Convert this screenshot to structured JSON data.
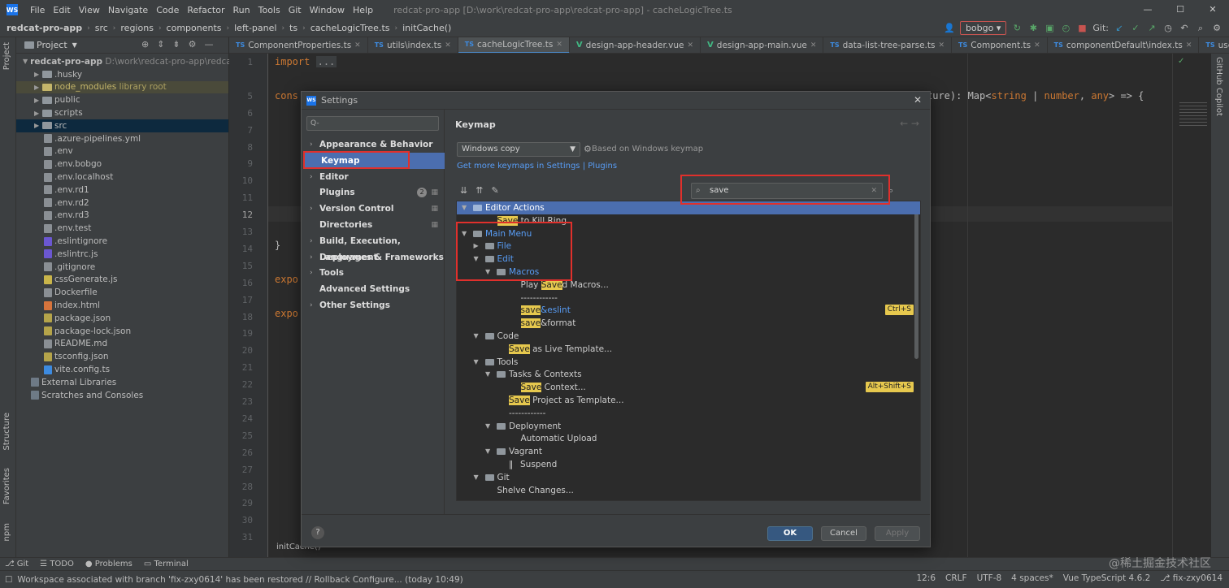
{
  "window": {
    "menu": [
      "File",
      "Edit",
      "View",
      "Navigate",
      "Code",
      "Refactor",
      "Run",
      "Tools",
      "Git",
      "Window",
      "Help"
    ],
    "title": "redcat-pro-app [D:\\work\\redcat-pro-app\\redcat-pro-app] - cacheLogicTree.ts"
  },
  "breadcrumb": [
    "redcat-pro-app",
    "src",
    "regions",
    "components",
    "left-panel",
    "ts",
    "cacheLogicTree.ts",
    "initCache()"
  ],
  "toolbar": {
    "run_config": "bobgo",
    "git_label": "Git:"
  },
  "project": {
    "header": "Project",
    "root": "redcat-pro-app",
    "root_path": "D:\\work\\redcat-pro-app\\redcat-",
    "node_modules_label": "node_modules",
    "library_root": "library root",
    "items": [
      ".husky",
      "node_modules",
      "public",
      "scripts",
      "src",
      ".azure-pipelines.yml",
      ".env",
      ".env.bobgo",
      ".env.localhost",
      ".env.rd1",
      ".env.rd2",
      ".env.rd3",
      ".env.test",
      ".eslintignore",
      ".eslintrc.js",
      ".gitignore",
      "cssGenerate.js",
      "Dockerfile",
      "index.html",
      "package.json",
      "package-lock.json",
      "README.md",
      "tsconfig.json",
      "vite.config.ts",
      "External Libraries",
      "Scratches and Consoles"
    ]
  },
  "tabs": [
    "ComponentProperties.ts",
    "utils\\index.ts",
    "cacheLogicTree.ts",
    "design-app-header.vue",
    "design-app-main.vue",
    "data-list-tree-parse.ts",
    "Component.ts",
    "componentDefault\\index.ts",
    "useDefaultProperties.ts"
  ],
  "editor": {
    "line_numbers": [
      "1",
      "",
      "5",
      "6",
      "7",
      "8",
      "9",
      "10",
      "11",
      "12",
      "13",
      "14",
      "15",
      "16",
      "17",
      "18",
      "19",
      "20",
      "21",
      "22",
      "23",
      "24",
      "25",
      "26",
      "27",
      "28",
      "29",
      "30",
      "31"
    ],
    "line1_kw": "import",
    "line1_fold": "...",
    "line5_kw": "cons",
    "line5_tail_a": "ture): Map<",
    "line5_tail_b": "string",
    "line5_tail_c": " | ",
    "line5_tail_d": "number",
    "line5_tail_e": ", ",
    "line5_tail_f": "any",
    "line5_tail_g": "> => {",
    "brace": "}",
    "expo1": "expo",
    "expo2": "expo",
    "footer_crumb": "initCache()"
  },
  "left_tool_tabs": [
    "Project",
    "Structure",
    "Favorites",
    "npm"
  ],
  "right_tool_tabs": [
    "GitHub Copilot"
  ],
  "dialog": {
    "title": "Settings",
    "search_placeholder": "Q-",
    "categories": [
      {
        "label": "Appearance & Behavior",
        "expandable": true
      },
      {
        "label": "Keymap",
        "expandable": false,
        "active": true
      },
      {
        "label": "Editor",
        "expandable": true
      },
      {
        "label": "Plugins",
        "expandable": false,
        "badge": "2"
      },
      {
        "label": "Version Control",
        "expandable": true
      },
      {
        "label": "Directories",
        "expandable": false
      },
      {
        "label": "Build, Execution, Deployment",
        "expandable": true
      },
      {
        "label": "Languages & Frameworks",
        "expandable": true
      },
      {
        "label": "Tools",
        "expandable": true
      },
      {
        "label": "Advanced Settings",
        "expandable": false
      },
      {
        "label": "Other Settings",
        "expandable": true
      }
    ],
    "keymap": {
      "title": "Keymap",
      "scheme": "Windows copy",
      "based_on": "Based on Windows keymap",
      "link_a": "Get more keymaps in Settings",
      "link_sep": " | ",
      "link_b": "Plugins",
      "search_value": "save"
    },
    "tree": [
      {
        "pre": "",
        "hl": "",
        "post": "Editor Actions",
        "indent": 0,
        "arrow": "down",
        "folder": true,
        "selected": true,
        "color": "white"
      },
      {
        "pre": "",
        "hl": "Save",
        "post": " to Kill Ring",
        "indent": 3,
        "arrow": "",
        "folder": false,
        "color": "white"
      },
      {
        "pre": "",
        "hl": "",
        "post": "Main Menu",
        "indent": 0,
        "arrow": "down",
        "folder": true,
        "color": "blue"
      },
      {
        "pre": "",
        "hl": "",
        "post": "File",
        "indent": 1,
        "arrow": "right",
        "folder": true,
        "color": "blue"
      },
      {
        "pre": "",
        "hl": "",
        "post": "Edit",
        "indent": 1,
        "arrow": "down",
        "folder": true,
        "color": "blue"
      },
      {
        "pre": "",
        "hl": "",
        "post": "Macros",
        "indent": 2,
        "arrow": "down",
        "folder": true,
        "color": "blue"
      },
      {
        "pre": "Play ",
        "hl": "Save",
        "post": "d Macros...",
        "indent": 5,
        "arrow": "",
        "folder": false,
        "color": "white"
      },
      {
        "pre": "",
        "hl": "",
        "post": "------------",
        "indent": 5,
        "arrow": "",
        "folder": false,
        "color": "white"
      },
      {
        "pre": "",
        "hl": "save",
        "post": "&eslint",
        "indent": 5,
        "arrow": "",
        "folder": false,
        "color": "blue",
        "shortcut": "Ctrl+S"
      },
      {
        "pre": "",
        "hl": "save",
        "post": "&format",
        "indent": 5,
        "arrow": "",
        "folder": false,
        "color": "white"
      },
      {
        "pre": "",
        "hl": "",
        "post": "Code",
        "indent": 1,
        "arrow": "down",
        "folder": true,
        "color": "white"
      },
      {
        "pre": "",
        "hl": "Save",
        "post": " as Live Template...",
        "indent": 4,
        "arrow": "",
        "folder": false,
        "color": "white"
      },
      {
        "pre": "",
        "hl": "",
        "post": "Tools",
        "indent": 1,
        "arrow": "down",
        "folder": true,
        "color": "white"
      },
      {
        "pre": "",
        "hl": "",
        "post": "Tasks & Contexts",
        "indent": 2,
        "arrow": "down",
        "folder": true,
        "color": "white"
      },
      {
        "pre": "",
        "hl": "Save",
        "post": " Context...",
        "indent": 5,
        "arrow": "",
        "folder": false,
        "color": "white",
        "shortcut": "Alt+Shift+S"
      },
      {
        "pre": "",
        "hl": "Save",
        "post": " Project as Template...",
        "indent": 4,
        "arrow": "",
        "folder": false,
        "color": "white"
      },
      {
        "pre": "",
        "hl": "",
        "post": "------------",
        "indent": 4,
        "arrow": "",
        "folder": false,
        "color": "white"
      },
      {
        "pre": "",
        "hl": "",
        "post": "Deployment",
        "indent": 2,
        "arrow": "down",
        "folder": true,
        "color": "white"
      },
      {
        "pre": "",
        "hl": "",
        "post": "Automatic Upload",
        "indent": 5,
        "arrow": "",
        "folder": false,
        "color": "white"
      },
      {
        "pre": "",
        "hl": "",
        "post": "Vagrant",
        "indent": 2,
        "arrow": "down",
        "folder": true,
        "color": "white"
      },
      {
        "pre": "",
        "hl": "",
        "post": "Suspend",
        "indent": 4,
        "arrow": "",
        "folder": false,
        "color": "white",
        "icon": "pause"
      },
      {
        "pre": "",
        "hl": "",
        "post": "Git",
        "indent": 1,
        "arrow": "down",
        "folder": true,
        "color": "white"
      },
      {
        "pre": "",
        "hl": "",
        "post": "Shelve Changes...",
        "indent": 3,
        "arrow": "",
        "folder": false,
        "color": "white"
      }
    ],
    "buttons": {
      "ok": "OK",
      "cancel": "Cancel",
      "apply": "Apply",
      "help": "?"
    }
  },
  "bottom_tools": [
    "Git",
    "TODO",
    "Problems",
    "Terminal"
  ],
  "status": {
    "message": "Workspace associated with branch 'fix-zxy0614' has been restored // Rollback   Configure... (today 10:49)",
    "position": "12:6",
    "line_sep": "CRLF",
    "encoding": "UTF-8",
    "indent": "4 spaces*",
    "lang": "Vue TypeScript 4.6.2",
    "branch": "fix-zxy0614"
  },
  "watermark": "@稀土掘金技术社区",
  "colors": {
    "accent": "#4b6eaf",
    "highlight": "#e6c84e",
    "annotation": "#e0302c"
  }
}
